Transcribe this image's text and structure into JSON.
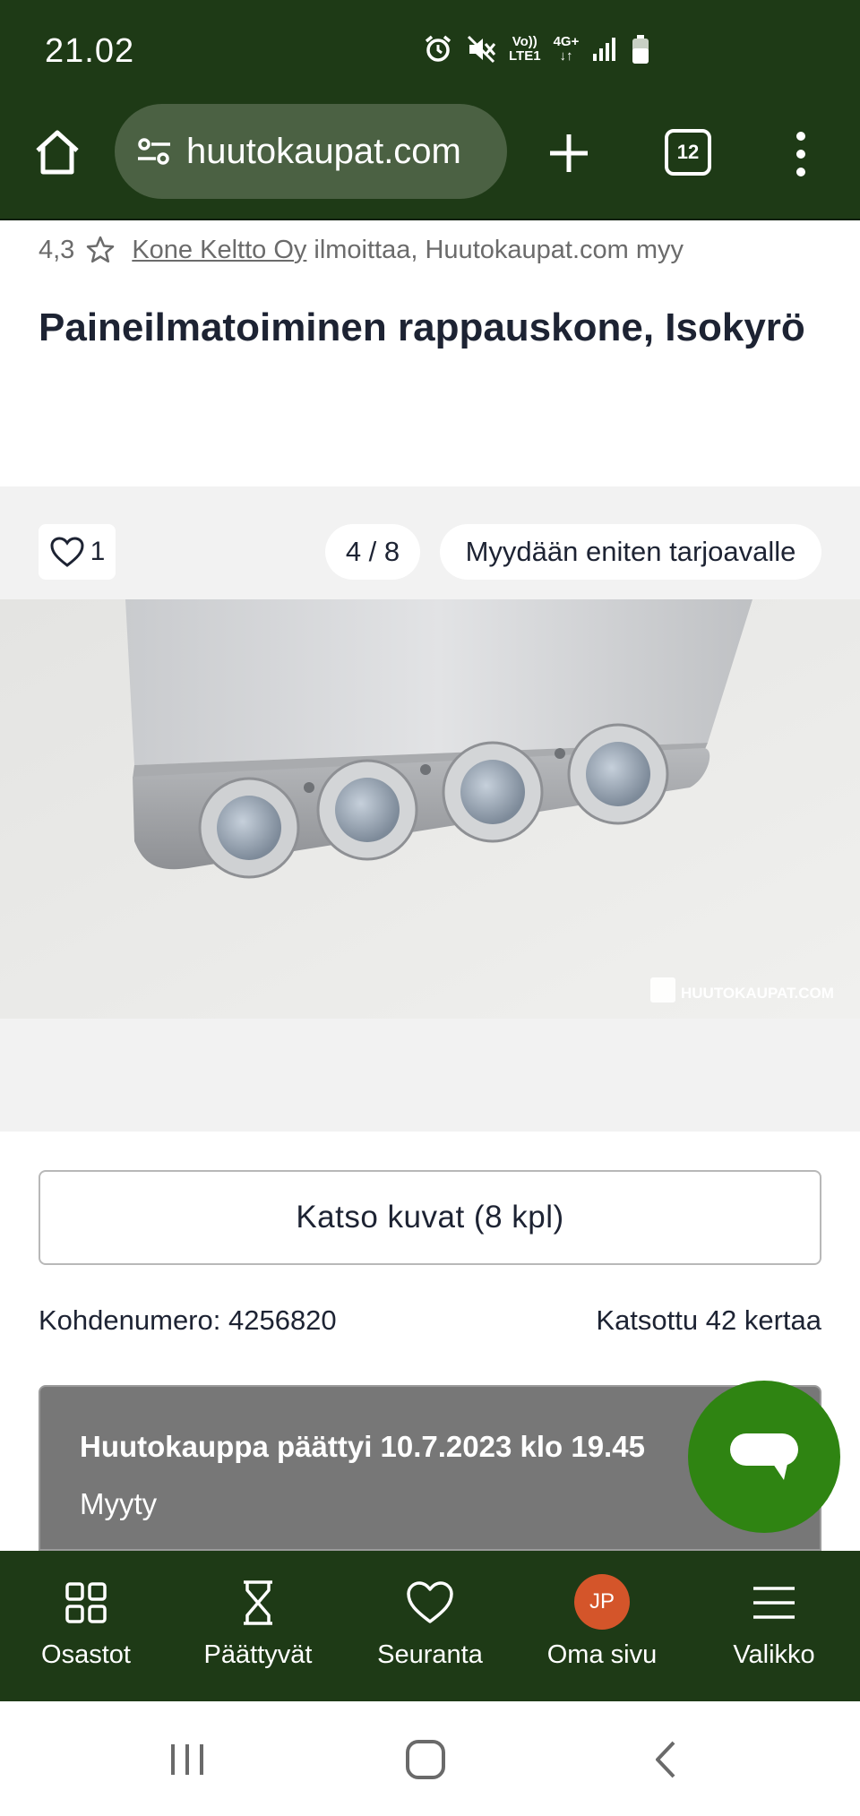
{
  "status_bar": {
    "time": "21.02",
    "volte_label": "Vo))\nLTE1",
    "network_label": "4G+"
  },
  "browser": {
    "url": "huutokaupat.com",
    "tab_count": "12"
  },
  "listing": {
    "rating": "4,3",
    "seller_name": "Kone Keltto Oy",
    "seller_suffix": "ilmoittaa, Huutokaupat.com myy",
    "title": "Paineilmatoiminen rappauskone, Isokyrö",
    "favorite_count": "1",
    "image_counter": "4 / 8",
    "sale_type": "Myydään eniten tarjoavalle",
    "watermark": "HUUTOKAUPAT.COM",
    "view_photos_label": "Katso kuvat (8 kpl)",
    "item_number": "Kohdenumero: 4256820",
    "view_count": "Katsottu 42 kertaa",
    "auction_ended": "Huutokauppa päättyi 10.7.2023 klo 19.45",
    "auction_status": "Myyty"
  },
  "bottom_nav": {
    "items": [
      {
        "label": "Osastot",
        "icon": "grid-icon"
      },
      {
        "label": "Päättyvät",
        "icon": "hourglass-icon"
      },
      {
        "label": "Seuranta",
        "icon": "heart-icon"
      },
      {
        "label": "Oma sivu",
        "icon": "avatar",
        "avatar_initials": "JP"
      },
      {
        "label": "Valikko",
        "icon": "menu-icon"
      }
    ]
  },
  "colors": {
    "header_bg": "#1e3a16",
    "url_pill_bg": "#4b6143",
    "chat_fab": "#2f8412",
    "avatar_bg": "#d4552a",
    "auction_box_bg": "#777777"
  }
}
